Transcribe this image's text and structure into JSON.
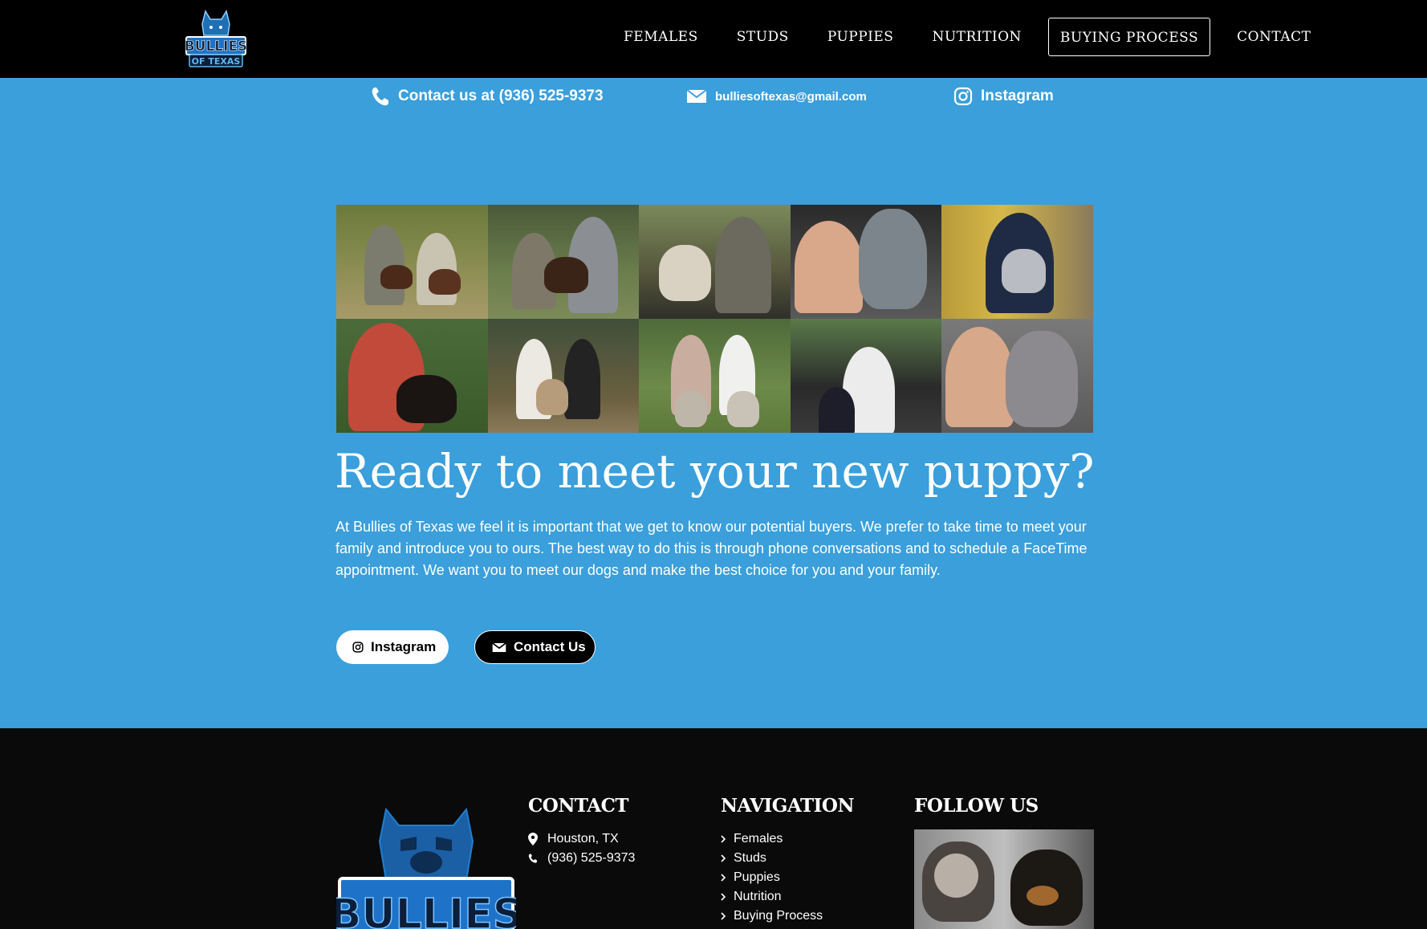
{
  "header": {
    "logo_name": "Bullies of Texas logo",
    "nav": [
      "FEMALES",
      "STUDS",
      "PUPPIES",
      "NUTRITION",
      "BUYING PROCESS",
      "CONTACT"
    ],
    "active": "BUYING PROCESS"
  },
  "contact_bar": {
    "phone": "Contact us at (936) 525-9373",
    "email": "bulliesoftexas@gmail.com",
    "instagram": "Instagram"
  },
  "hero": {
    "headline": "Ready to meet your new puppy?",
    "paragraph": "At Bullies of Texas we feel it is important that we get to know our potential buyers. We prefer to take time to meet your family and introduce you to ours. The best way to do this is through phone conversations and to schedule a FaceTime appointment. We want you to meet our dogs and make the best choice for you and your family.",
    "btn_instagram": "Instagram",
    "btn_contact": "Contact Us"
  },
  "footer": {
    "contact_title": "CONTACT",
    "location": "Houston, TX",
    "phone": "(936) 525-9373",
    "nav_title": "NAVIGATION",
    "nav_items": [
      "Females",
      "Studs",
      "Puppies",
      "Nutrition",
      "Buying Process"
    ],
    "follow_title": "FOLLOW US"
  },
  "colors": {
    "primary_blue": "#3a9fdb",
    "header_bg": "#000000",
    "footer_bg": "#0a0a0a"
  }
}
